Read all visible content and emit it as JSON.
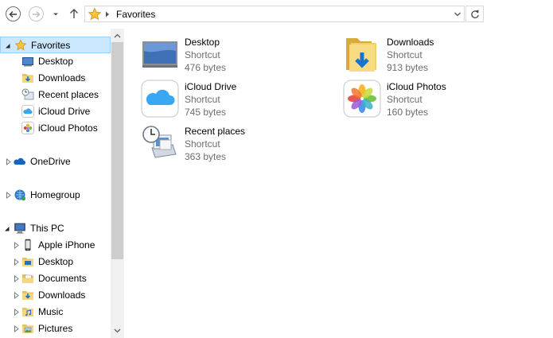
{
  "address_bar": {
    "breadcrumb": "Favorites"
  },
  "nav_pane": {
    "favorites": {
      "label": "Favorites",
      "children": [
        "Desktop",
        "Downloads",
        "Recent places",
        "iCloud Drive",
        "iCloud Photos"
      ]
    },
    "onedrive": {
      "label": "OneDrive"
    },
    "homegroup": {
      "label": "Homegroup"
    },
    "this_pc": {
      "label": "This PC",
      "children": [
        "Apple iPhone",
        "Desktop",
        "Documents",
        "Downloads",
        "Music",
        "Pictures"
      ]
    }
  },
  "content": {
    "items": [
      {
        "name": "Desktop",
        "type": "Shortcut",
        "size": "476 bytes",
        "icon": "desktop-icon"
      },
      {
        "name": "Downloads",
        "type": "Shortcut",
        "size": "913 bytes",
        "icon": "downloads-folder-icon"
      },
      {
        "name": "iCloud Drive",
        "type": "Shortcut",
        "size": "745 bytes",
        "icon": "icloud-drive-icon"
      },
      {
        "name": "iCloud Photos",
        "type": "Shortcut",
        "size": "160 bytes",
        "icon": "icloud-photos-icon"
      },
      {
        "name": "Recent places",
        "type": "Shortcut",
        "size": "363 bytes",
        "icon": "recent-places-icon"
      }
    ]
  },
  "colors": {
    "selection_bg": "#cce8ff",
    "selection_border": "#99d1ff",
    "secondary_text": "#6d6d6d",
    "scrollbar_track": "#f0f0f0",
    "scrollbar_thumb": "#cdcdcd"
  }
}
